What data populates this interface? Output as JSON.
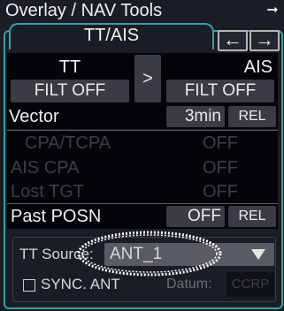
{
  "window": {
    "title": "Overlay / NAV Tools",
    "corner_icon": "pin-arrow-icon"
  },
  "tab": {
    "label": "TT/AIS"
  },
  "nav": {
    "prev_icon": "arrow-left-icon",
    "next_icon": "arrow-right-icon",
    "prev_glyph": "←",
    "next_glyph": "→"
  },
  "filter": {
    "tt_label": "TT",
    "tt_value": "FILT OFF",
    "swap_symbol": ">",
    "ais_label": "AIS",
    "ais_value": "FILT OFF"
  },
  "rows": [
    {
      "label": "Vector",
      "value": "3min",
      "mode": "REL",
      "enabled": true
    },
    {
      "label": "CPA/TCPA",
      "value": "OFF",
      "enabled": false
    },
    {
      "label": "AIS CPA",
      "value": "OFF",
      "enabled": false
    },
    {
      "label": "Lost TGT",
      "value": "OFF",
      "enabled": false
    },
    {
      "label": "Past POSN",
      "value": "OFF",
      "mode": "REL",
      "enabled": true
    }
  ],
  "tt_source": {
    "label": "TT Source:",
    "value": "ANT_1"
  },
  "sync_ant": {
    "label": "SYNC. ANT",
    "checked": false
  },
  "datum": {
    "label": "Datum:",
    "value": "CCRP"
  },
  "colors": {
    "accent": "#3a9ea0",
    "background": "#1b1d26",
    "button": "#3a3b43",
    "disabled_text": "#3b3e49"
  }
}
